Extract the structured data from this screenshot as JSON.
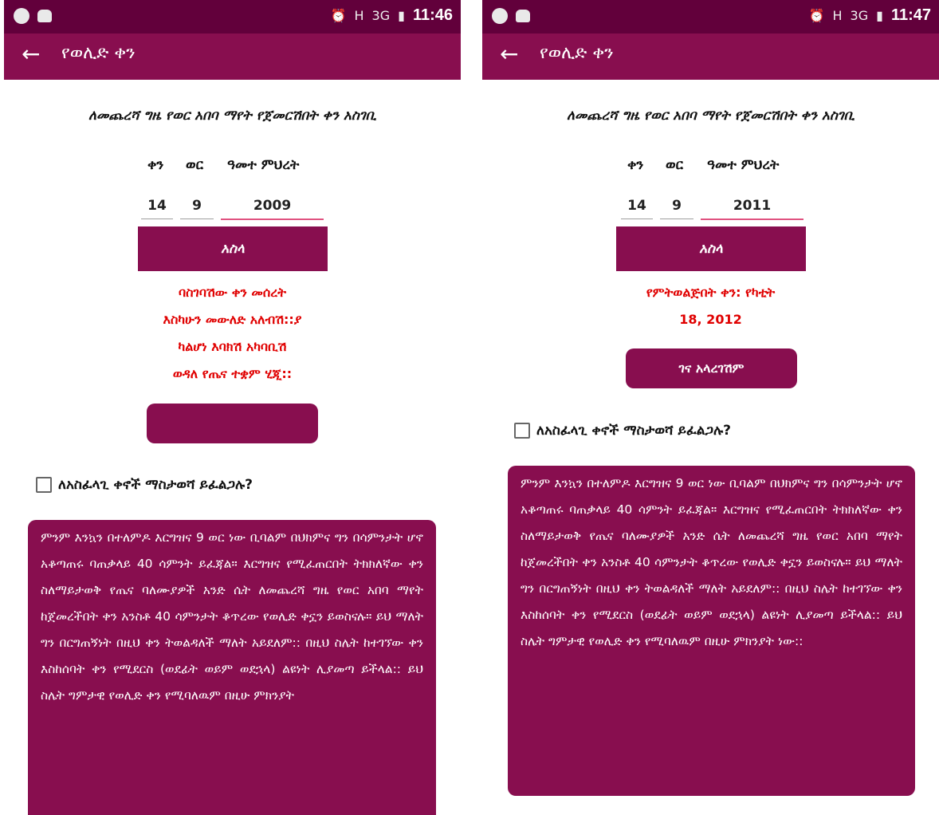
{
  "screens": [
    {
      "status": {
        "time": "11:46",
        "network": "H",
        "signal": "3G"
      },
      "header": {
        "back": "←",
        "title": "የወሊድ ቀን"
      },
      "prompt": "ለመጨረሻ ግዜ የወር አበባ ማየት የጀመርሽበት ቀን አስገቢ",
      "labels": {
        "day": "ቀን",
        "month": "ወር",
        "year": "ዓመተ ምህረት"
      },
      "inputs": {
        "day": "14",
        "month": "9",
        "year": "2009"
      },
      "calculate_label": "አስላ",
      "result_lines": [
        "ባስገባሽው ቀን መሰረት",
        "እስካሁን መውለድ አለብሽ::ያ",
        "ካልሆነ እባክሽ አካባቢሽ",
        "ወዳለ የጤና ተቋም ሂጂ::"
      ],
      "secondary_button": "",
      "checkbox_label": "ለአስፈላጊ ቀኖች ማስታወሻ ይፈልጋሉ?",
      "info_text": "ምንም እንኳን በተለምዶ እርግዝና 9 ወር ነው ቢባልም በህክምና ግን በሳምንታት ሆኖ አቆጣጠሩ ባጠቃላይ 40 ሳምንት ይፈጃል። እርግዝና የሚፈጠርበት ትክክለኛው ቀን ስለማይታወቅ የጤና ባለሙያዎች አንድ ሴት ለመጨረሻ ግዜ የወር አበባ ማየት ከጀመረችበት ቀን አንስቶ 40 ሳምንታት ቆጥረው የወሊድ ቀኗን ይወስናሉ። ይህ ማለት ግን በርግጠኝነት በዚህ ቀን ትወልዳለች ማለት አይደለም:: በዚህ ስሌት ከተገኘው ቀን እስከሰባት ቀን የሚደርስ (ወደፊት ወይም ወደኋላ) ልዩነት ሊያመጣ ይችላል:: ይህ ስሌት ግምታዊ የወሊድ ቀን የሚባለዉም በዚሁ ምክንያት"
    },
    {
      "status": {
        "time": "11:47",
        "network": "H",
        "signal": "3G"
      },
      "header": {
        "back": "←",
        "title": "የወሊድ ቀን"
      },
      "prompt": "ለመጨረሻ ግዜ የወር አበባ ማየት የጀመርሽበት ቀን አስገቢ",
      "labels": {
        "day": "ቀን",
        "month": "ወር",
        "year": "ዓመተ ምህረት"
      },
      "inputs": {
        "day": "14",
        "month": "9",
        "year": "2011"
      },
      "calculate_label": "አስላ",
      "result_lines": [
        "የምትወልጅበት ቀን: የካቲት",
        "18, 2012"
      ],
      "secondary_button": "ገና አላረገሽም",
      "checkbox_label": "ለአስፈላጊ ቀኖች ማስታወሻ ይፈልጋሉ?",
      "info_text": "ምንም እንኳን በተለምዶ እርግዝና 9 ወር ነው ቢባልም በህክምና ግን በሳምንታት ሆኖ አቆጣጠሩ ባጠቃላይ 40 ሳምንት ይፈጃል። እርግዝና የሚፈጠርበት ትክክለኛው ቀን ስለማይታወቅ የጤና ባለሙያዎች አንድ ሴት ለመጨረሻ ግዜ የወር አበባ ማየት ከጀመረችበት ቀን አንስቶ 40 ሳምንታት ቆጥረው የወሊድ ቀኗን ይወስናሉ። ይህ ማለት ግን በርግጠኝነት በዚህ ቀን ትወልዳለች ማለት አይደለም:: በዚህ ስሌት ከተገኘው ቀን እስከሰባት ቀን የሚደርስ (ወደፊት ወይም ወደኋላ) ልዩነት ሊያመጣ ይችላል:: ይህ ስሌት ግምታዊ የወሊድ ቀን የሚባለዉም በዚሁ ምክንያት ነው::"
    }
  ],
  "colors": {
    "primary": "#880e4f",
    "status_bar": "#62003b",
    "result_text": "#e00000",
    "accent_underline": "#e05280"
  }
}
